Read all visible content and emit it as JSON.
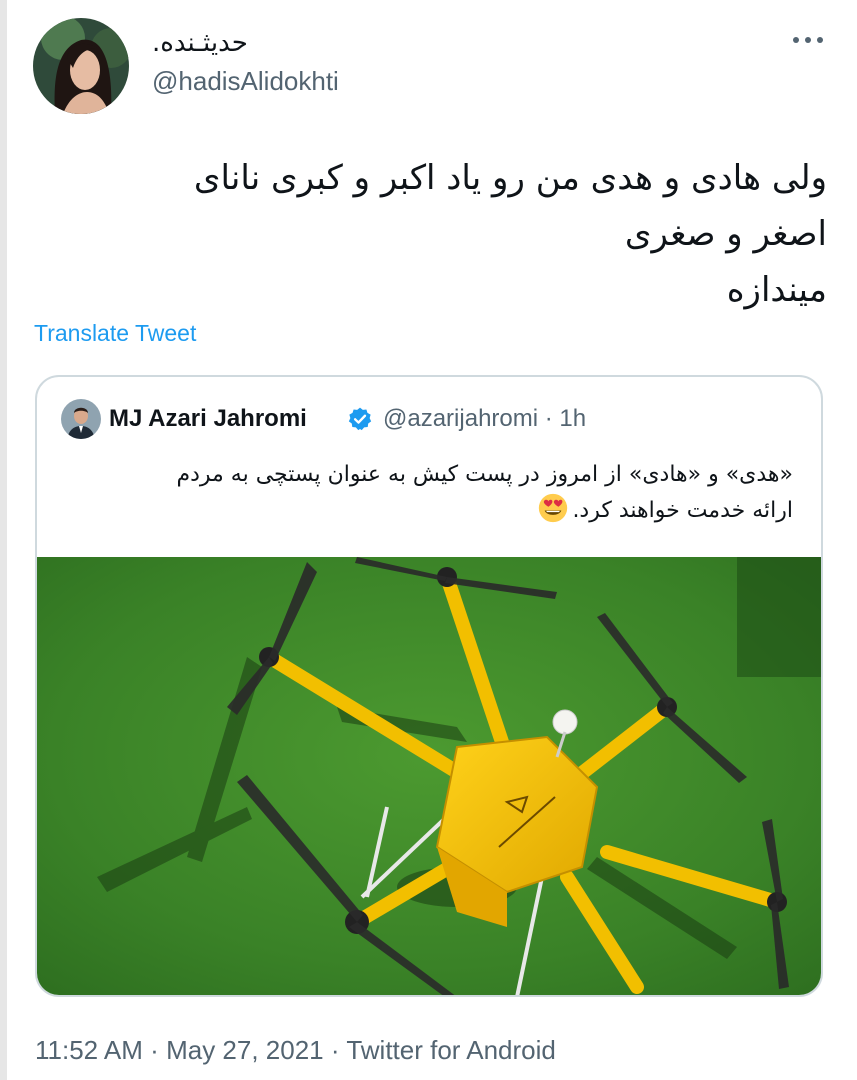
{
  "author": {
    "display_name": "حدیثـنده.",
    "handle": "@hadisAlidokhti"
  },
  "tweet": {
    "lines": [
      "ولی هادی و هدی من رو یاد اکبر و کبری  نانای",
      "اصغر و صغری",
      "میندازه"
    ]
  },
  "translate_label": "Translate Tweet",
  "quoted": {
    "name": "MJ Azari Jahromi",
    "handle": "@azarijahromi",
    "separator": "·",
    "time": "1h",
    "lines": [
      "«هدی» و «هادی» از امروز در پست کیش به عنوان پستچی به مردم",
      "ارائه خدمت خواهند کرد."
    ],
    "emoji": "smiling-face-with-heart-eyes"
  },
  "footer": {
    "time": "11:52 AM",
    "separator_1": "·",
    "date": "May 27, 2021",
    "separator_2": "·",
    "source": "Twitter for Android"
  },
  "colors": {
    "link": "#1d9bf0",
    "secondary_text": "#536471",
    "border": "#cfd9de",
    "verified": "#1d9bf0",
    "drone_yellow": "#f5c400",
    "grass": "#3f8a2a"
  }
}
